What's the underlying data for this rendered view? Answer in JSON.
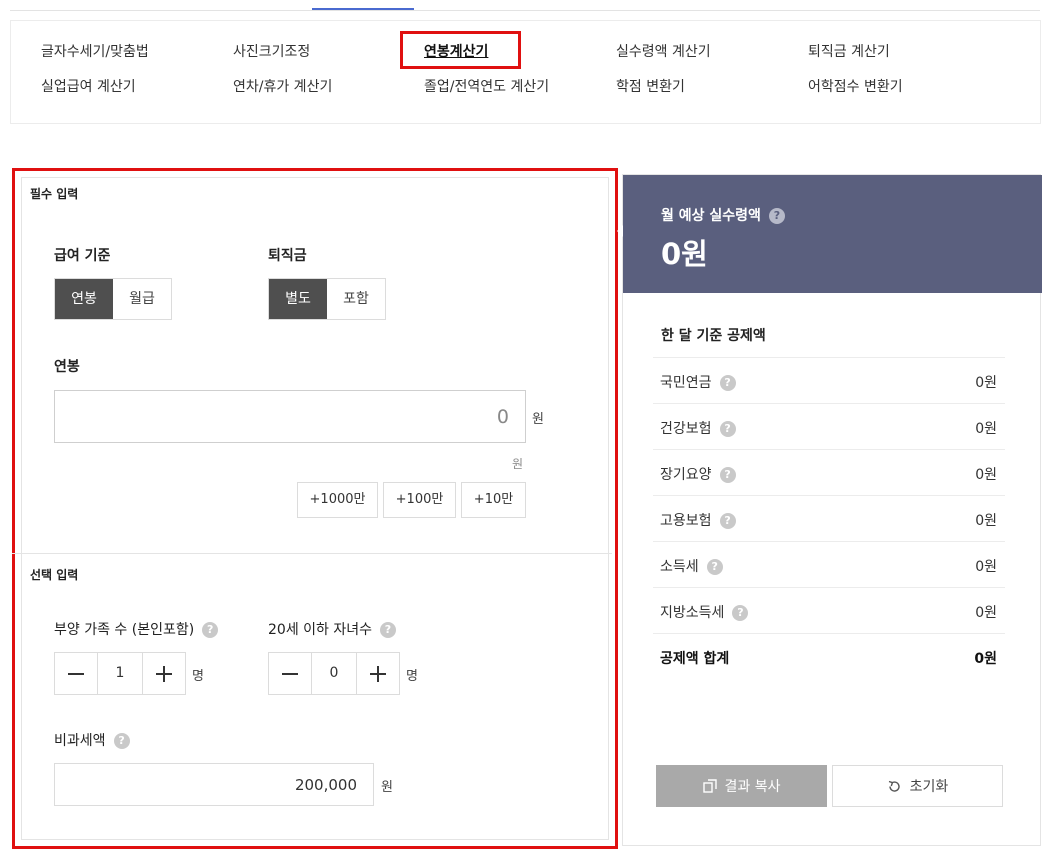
{
  "nav": {
    "items": [
      {
        "label": "글자수세기/맞춤법"
      },
      {
        "label": "사진크기조정"
      },
      {
        "label": "연봉계산기"
      },
      {
        "label": "실수령액 계산기"
      },
      {
        "label": "퇴직금 계산기"
      },
      {
        "label": "실업급여 계산기"
      },
      {
        "label": "연차/휴가 계산기"
      },
      {
        "label": "졸업/전역연도 계산기"
      },
      {
        "label": "학점 변환기"
      },
      {
        "label": "어학점수 변환기"
      }
    ],
    "active": "연봉계산기"
  },
  "required": {
    "title": "필수 입력",
    "pay_basis": {
      "label": "급여 기준",
      "options": [
        "연봉",
        "월급"
      ],
      "selected": "연봉"
    },
    "severance": {
      "label": "퇴직금",
      "options": [
        "별도",
        "포함"
      ],
      "selected": "별도"
    },
    "salary": {
      "label": "연봉",
      "value": "0",
      "unit": "원",
      "hint": "원"
    },
    "quick_add": [
      "+1000만",
      "+100만",
      "+10만"
    ]
  },
  "optional": {
    "title": "선택 입력",
    "dependents": {
      "label": "부양 가족 수 (본인포함)",
      "value": "1",
      "unit": "명"
    },
    "children": {
      "label": "20세 이하 자녀수",
      "value": "0",
      "unit": "명"
    },
    "nontax": {
      "label": "비과세액",
      "value": "200,000",
      "unit": "원"
    }
  },
  "help_glyph": "?",
  "summary": {
    "label": "월 예상 실수령액",
    "amount": "0원",
    "deduction_title": "한 달 기준 공제액",
    "deductions": [
      {
        "name": "국민연금",
        "amount": "0원"
      },
      {
        "name": "건강보험",
        "amount": "0원"
      },
      {
        "name": "장기요양",
        "amount": "0원"
      },
      {
        "name": "고용보험",
        "amount": "0원"
      },
      {
        "name": "소득세",
        "amount": "0원"
      },
      {
        "name": "지방소득세",
        "amount": "0원"
      }
    ],
    "total": {
      "name": "공제액 합계",
      "amount": "0원"
    },
    "copy_label": "결과 복사",
    "reset_label": "초기화"
  },
  "icons": [
    "help-icon",
    "minus-icon",
    "plus-icon",
    "copy-icon",
    "reset-icon"
  ],
  "colors": {
    "highlight": "#e01010",
    "summary_bg": "#5a5f7e",
    "toggle_on": "#4f4f4f",
    "copy_btn": "#a9a9a9"
  }
}
